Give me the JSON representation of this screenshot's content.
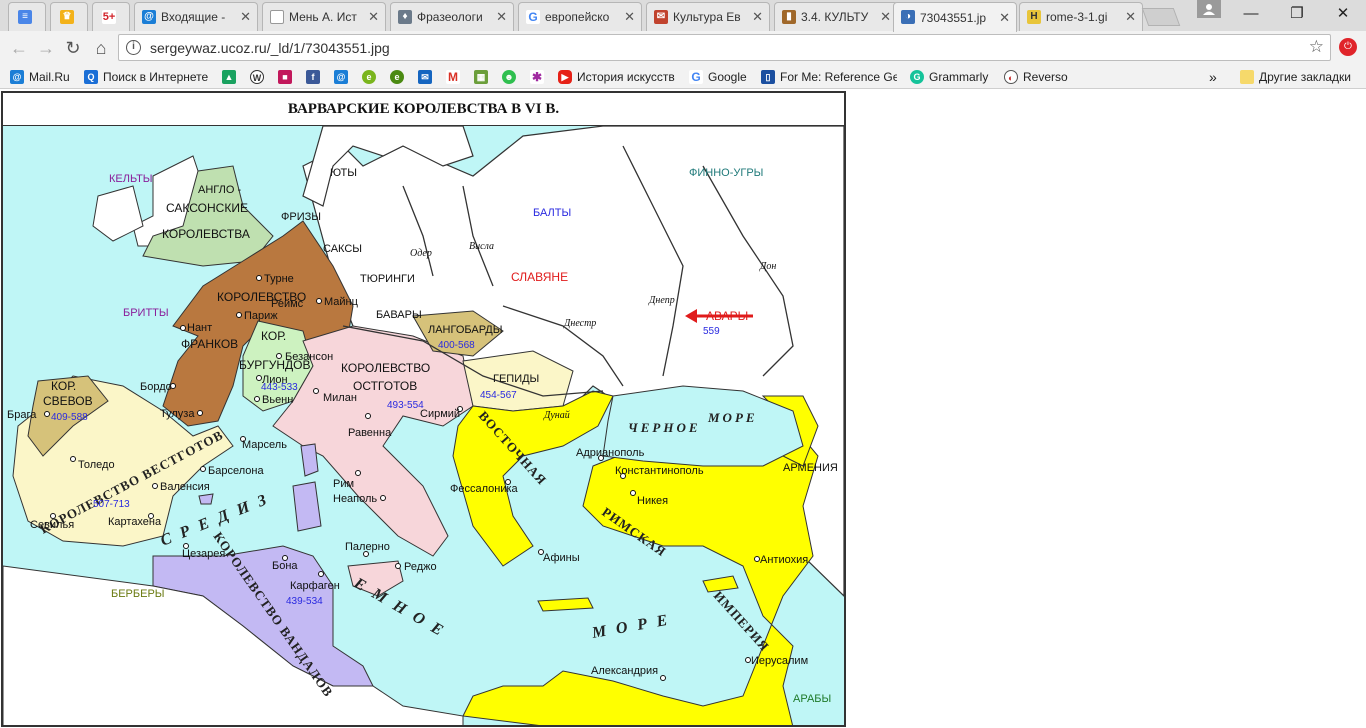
{
  "browser": {
    "tabs": [
      {
        "title": "",
        "icon": "google-docs-icon",
        "active": false
      },
      {
        "title": "",
        "icon": "crown-icon",
        "active": false
      },
      {
        "title": "",
        "icon": "five-plus-icon",
        "active": false
      },
      {
        "title": "Входящие -",
        "icon": "mailru-icon",
        "active": false
      },
      {
        "title": "Мень А. Ист",
        "icon": "document-icon",
        "active": false
      },
      {
        "title": "Фразеологи",
        "icon": "lamp-icon",
        "active": false
      },
      {
        "title": "европейско",
        "icon": "google-icon",
        "active": false
      },
      {
        "title": "Культура Ев",
        "icon": "mail-icon",
        "active": false
      },
      {
        "title": "3.4. КУЛЬТУ",
        "icon": "book-icon",
        "active": false
      },
      {
        "title": "73043551.jp",
        "icon": "ucoz-icon",
        "active": true
      },
      {
        "title": "rome-3-1.gi",
        "icon": "h-icon",
        "active": false
      }
    ],
    "window_controls": {
      "minimize": "—",
      "maximize": "❐",
      "close": "✕"
    },
    "nav": {
      "back": "←",
      "forward": "→",
      "reload": "↻",
      "home": "⌂"
    },
    "url": "sergeywaz.ucoz.ru/_ld/1/73043551.jpg",
    "bookmarks": [
      {
        "label": "Mail.Ru",
        "icon": "mailru-icon"
      },
      {
        "label": "Поиск в Интернете",
        "icon": "search-icon"
      },
      {
        "label": "",
        "icon": "drive-icon"
      },
      {
        "label": "",
        "icon": "wordpress-icon"
      },
      {
        "label": "",
        "icon": "flag-icon"
      },
      {
        "label": "",
        "icon": "facebook-icon"
      },
      {
        "label": "",
        "icon": "mailru-icon"
      },
      {
        "label": "",
        "icon": "edge-icon"
      },
      {
        "label": "",
        "icon": "edge-icon"
      },
      {
        "label": "",
        "icon": "mail-icon"
      },
      {
        "label": "",
        "icon": "gmail-icon"
      },
      {
        "label": "",
        "icon": "minecraft-icon"
      },
      {
        "label": "",
        "icon": "frog-icon"
      },
      {
        "label": "",
        "icon": "bug-icon"
      },
      {
        "label": "История искусств",
        "icon": "youtube-icon"
      },
      {
        "label": "Google",
        "icon": "google-icon"
      },
      {
        "label": "For Me: Reference Ge",
        "icon": "bookmark-icon"
      },
      {
        "label": "Grammarly",
        "icon": "grammarly-icon"
      },
      {
        "label": "Reverso",
        "icon": "reverso-icon"
      }
    ],
    "overflow": "»",
    "other_bookmarks": "Другие закладки"
  },
  "map": {
    "title": "ВАРВАРСКИЕ КОРОЛЕВСТВА В VI В.",
    "peoples": {
      "kelts": "КЕЛЬТЫ",
      "yuty": "ЮТЫ",
      "frizy": "ФРИЗЫ",
      "saksy": "САКСЫ",
      "tyuringi": "ТЮРИНГИ",
      "bavary": "БАВАРЫ",
      "britty": "БРИТТЫ",
      "balty": "БАЛТЫ",
      "slavyane": "СЛАВЯНЕ",
      "finno_ugry": "ФИННО-УГРЫ",
      "avary": "АВАРЫ",
      "berbery": "БЕРБЕРЫ",
      "araby": "АРАБЫ",
      "armeniya": "АРМЕНИЯ"
    },
    "kingdoms": {
      "anglo_saxon_1": "АНГЛО -",
      "anglo_saxon_2": "САКСОНСКИЕ",
      "anglo_saxon_3": "КОРОЛЕВСТВА",
      "franks_1": "КОРОЛЕВСТВО",
      "franks_2": "ФРАНКОВ",
      "burgund_1": "КОР.",
      "burgund_2": "БУРГУНДОВ",
      "burgund_dates": "443-533",
      "ostgoth_1": "КОРОЛЕВСТВО",
      "ostgoth_2": "ОСТГОТОВ",
      "ostgoth_dates": "493-554",
      "langobard": "ЛАНГОБАРДЫ",
      "langobard_dates": "400-568",
      "gepid": "ГЕПИДЫ",
      "gepid_dates": "454-567",
      "suev_1": "КОР.",
      "suev_2": "СВЕВОВ",
      "suev_dates": "409-588",
      "visigoth": "КОРОЛЕВСТВО ВЕСТГОТОВ",
      "visigoth_dates": "507-713",
      "vandal": "КОРОЛЕВСТВО ВАНДАЛОВ",
      "vandal_dates": "439-534",
      "avar_dates": "559",
      "east_roman_1": "ВОСТОЧНАЯ",
      "east_roman_2": "РИМСКАЯ",
      "east_roman_3": "ИМПЕРИЯ"
    },
    "seas": {
      "black_sea_1": "ЧЕРНОЕ",
      "black_sea_2": "МОРЕ",
      "med_1": "С Р Е Д И З",
      "med_2": "Е М Н О Е",
      "med_3": "М О Р Е"
    },
    "rivers": {
      "oder": "Одер",
      "vistula": "Висла",
      "dnieper": "Днепр",
      "dniester": "Днестр",
      "don": "Дон",
      "danube": "Дунай"
    },
    "cities": {
      "turne": "Турне",
      "reims": "Реймс",
      "mainz": "Майнц",
      "parizh": "Париж",
      "nant": "Нант",
      "bezanson": "Безансон",
      "lion": "Лион",
      "vienn": "Вьенн",
      "bordo": "Бордо",
      "tuluza": "Тулуза",
      "milan": "Милан",
      "ravenna": "Равенна",
      "sirmiy": "Сирмий",
      "marsel": "Марсель",
      "barselona": "Барселона",
      "toledo": "Толедо",
      "valensiya": "Валенсия",
      "kartahena": "Картахена",
      "sevilya": "Севилья",
      "braga": "Брага",
      "rim": "Рим",
      "neapol": "Неаполь",
      "palermo": "Палерно",
      "redzho": "Реджо",
      "cezareya": "Цезарея",
      "bona": "Бона",
      "karfagen": "Карфаген",
      "fessalonika": "Фессалоника",
      "afiny": "Афины",
      "adrianopol": "Адрианополь",
      "konstantinopol": "Константинополь",
      "nikeya": "Никея",
      "antiohiya": "Антиохия",
      "ierusalim": "Иерусалим",
      "aleksandriya": "Александрия"
    }
  }
}
